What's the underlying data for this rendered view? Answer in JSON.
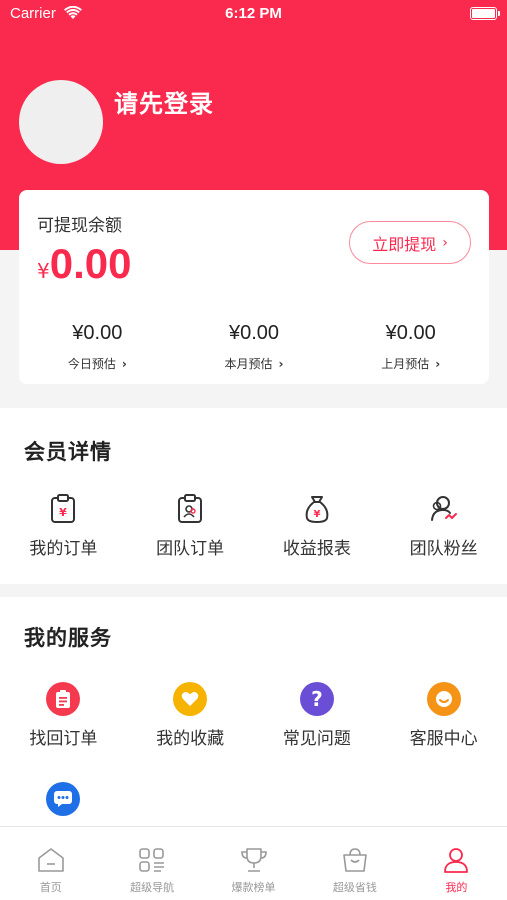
{
  "status_bar": {
    "carrier": "Carrier",
    "time": "6:12 PM"
  },
  "profile": {
    "login_prompt": "请先登录"
  },
  "balance": {
    "label": "可提现余额",
    "currency": "¥",
    "amount": "0.00",
    "withdraw_label": "立即提现",
    "stats": [
      {
        "value": "¥0.00",
        "label": "今日预估"
      },
      {
        "value": "¥0.00",
        "label": "本月预估"
      },
      {
        "value": "¥0.00",
        "label": "上月预估"
      }
    ]
  },
  "member": {
    "title": "会员详情",
    "items": [
      {
        "label": "我的订单",
        "icon": "order-clipboard-icon"
      },
      {
        "label": "团队订单",
        "icon": "team-clipboard-icon"
      },
      {
        "label": "收益报表",
        "icon": "money-bag-icon"
      },
      {
        "label": "团队粉丝",
        "icon": "fans-icon"
      }
    ]
  },
  "services": {
    "title": "我的服务",
    "items": [
      {
        "label": "找回订单",
        "icon": "recover-order-icon",
        "color": "#f53a4f"
      },
      {
        "label": "我的收藏",
        "icon": "heart-icon",
        "color": "#f6b400"
      },
      {
        "label": "常见问题",
        "icon": "question-icon",
        "color": "#6a4fd6"
      },
      {
        "label": "客服中心",
        "icon": "smile-icon",
        "color": "#f59316"
      },
      {
        "label": "",
        "icon": "chat-icon",
        "color": "#1f6fe6"
      }
    ]
  },
  "tabbar": {
    "items": [
      {
        "label": "首页",
        "icon": "home-icon"
      },
      {
        "label": "超级导航",
        "icon": "grid-icon"
      },
      {
        "label": "爆款榜单",
        "icon": "trophy-icon"
      },
      {
        "label": "超级省钱",
        "icon": "bag-icon"
      },
      {
        "label": "我的",
        "icon": "user-icon",
        "active": true
      }
    ]
  },
  "colors": {
    "brand": "#fa2a4f",
    "background": "#f4f4f4",
    "muted": "#999999"
  }
}
